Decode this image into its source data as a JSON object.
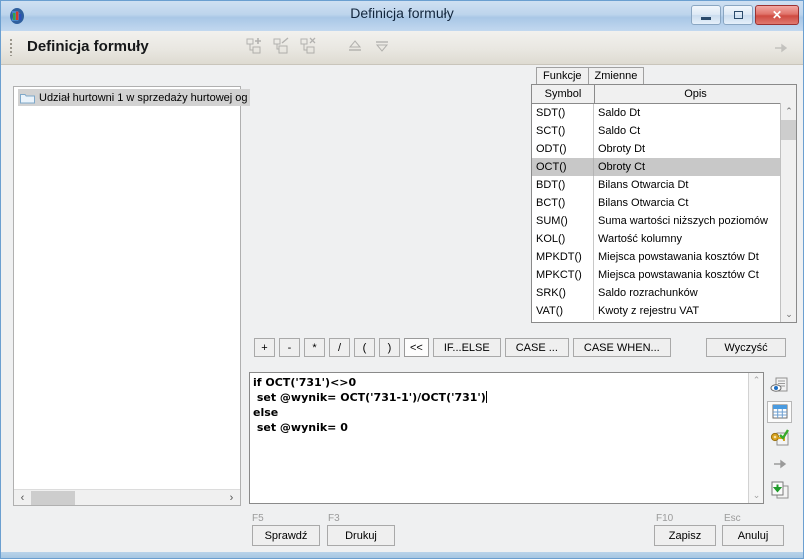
{
  "window": {
    "title": "Definicja formuły",
    "app_icon": "chart-app-icon",
    "minimize_label": "",
    "maximize_label": "",
    "close_label": "✕"
  },
  "header": {
    "title": "Definicja formuły",
    "icons": [
      {
        "name": "add-node-icon"
      },
      {
        "name": "edit-node-icon"
      },
      {
        "name": "delete-node-icon"
      },
      {
        "name": "move-up-icon"
      },
      {
        "name": "move-down-icon"
      }
    ],
    "right_icon": "link-icon"
  },
  "tree": {
    "items": [
      {
        "label": "Udział hurtowni 1 w sprzedaży hurtowej og",
        "icon": "folder-icon",
        "selected": true
      }
    ],
    "scroll": {
      "left_arrow": "‹",
      "right_arrow": "›"
    }
  },
  "tabs": [
    {
      "label": "Funkcje",
      "active": true
    },
    {
      "label": "Zmienne",
      "active": false
    }
  ],
  "functions_list": {
    "columns": [
      "Symbol",
      "Opis"
    ],
    "rows": [
      {
        "symbol": "SDT()",
        "desc": "Saldo Dt",
        "selected": false
      },
      {
        "symbol": "SCT()",
        "desc": "Saldo Ct",
        "selected": false
      },
      {
        "symbol": "ODT()",
        "desc": "Obroty Dt",
        "selected": false
      },
      {
        "symbol": "OCT()",
        "desc": "Obroty Ct",
        "selected": true
      },
      {
        "symbol": "BDT()",
        "desc": "Bilans Otwarcia Dt",
        "selected": false
      },
      {
        "symbol": "BCT()",
        "desc": "Bilans Otwarcia Ct",
        "selected": false
      },
      {
        "symbol": "SUM()",
        "desc": "Suma wartości niższych poziomów",
        "selected": false
      },
      {
        "symbol": "KOL()",
        "desc": "Wartość kolumny",
        "selected": false
      },
      {
        "symbol": "MPKDT()",
        "desc": "Miejsca powstawania kosztów Dt",
        "selected": false
      },
      {
        "symbol": "MPKCT()",
        "desc": "Miejsca powstawania kosztów Ct",
        "selected": false
      },
      {
        "symbol": "SRK()",
        "desc": "Saldo rozrachunków",
        "selected": false
      },
      {
        "symbol": "VAT()",
        "desc": "Kwoty z rejestru VAT",
        "selected": false
      }
    ],
    "scroll": {
      "up_arrow": "⌃",
      "down_arrow": "⌄"
    }
  },
  "operators": {
    "buttons": [
      {
        "label": "+",
        "name": "plus-button",
        "hover": false
      },
      {
        "label": "-",
        "name": "minus-button",
        "hover": false
      },
      {
        "label": "*",
        "name": "multiply-button",
        "hover": false
      },
      {
        "label": "/",
        "name": "divide-button",
        "hover": false
      },
      {
        "label": "(",
        "name": "open-paren-button",
        "hover": false
      },
      {
        "label": ")",
        "name": "close-paren-button",
        "hover": false
      },
      {
        "label": "<<",
        "name": "insert-button",
        "hover": true
      },
      {
        "label": "IF...ELSE",
        "name": "if-else-button",
        "hover": false
      },
      {
        "label": "CASE ...",
        "name": "case-button",
        "hover": false
      },
      {
        "label": "CASE WHEN...",
        "name": "case-when-button",
        "hover": false
      }
    ],
    "clear_label": "Wyczyść"
  },
  "editor": {
    "lines": [
      "if OCT('731')<>0",
      " set @wynik= OCT('731-1')/OCT('731')",
      "else",
      " set @wynik= 0"
    ],
    "caret_line": 1
  },
  "side_tools": [
    {
      "name": "preview-document-icon",
      "pressed": false
    },
    {
      "name": "table-grid-icon",
      "pressed": true
    },
    {
      "name": "key-check-icon",
      "pressed": false
    },
    {
      "name": "link-icon",
      "pressed": false
    },
    {
      "name": "download-document-icon",
      "pressed": false
    }
  ],
  "footer": {
    "buttons": [
      {
        "key": "F5",
        "label": "Sprawdź",
        "name": "check-button"
      },
      {
        "key": "F3",
        "label": "Drukuj",
        "name": "print-button"
      },
      {
        "key": "F10",
        "label": "Zapisz",
        "name": "save-button"
      },
      {
        "key": "Esc",
        "label": "Anuluj",
        "name": "cancel-button"
      }
    ]
  },
  "colors": {
    "titlebar": "#bdd4ec",
    "accent": "#a6c6e2",
    "selection": "#c8c8c8",
    "panel_bg": "#efefef"
  }
}
